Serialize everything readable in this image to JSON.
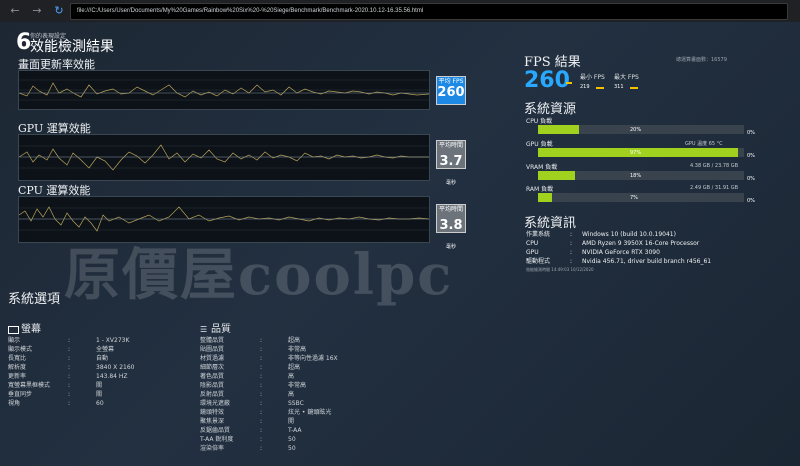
{
  "browser": {
    "url": "file:///C:/Users/User/Documents/My%20Games/Rainbow%20Six%20-%20Siege/Benchmark/Benchmark-2020.10.12-16.35.56.html"
  },
  "header": {
    "logo_number": "6",
    "subtitle": "你的表現設定",
    "title": "效能檢測結果"
  },
  "charts": [
    {
      "title": "畫面更新率效能",
      "label": "平均 FPS",
      "value": "260",
      "unit": "",
      "style": "blue"
    },
    {
      "title": "GPU 運算效能",
      "label": "平均時間",
      "value": "3.7",
      "unit": "毫秒",
      "style": "gray"
    },
    {
      "title": "CPU 運算效能",
      "label": "平均時間",
      "value": "3.8",
      "unit": "毫秒",
      "style": "gray"
    }
  ],
  "fps": {
    "title": "FPS 結果",
    "total_frames_label": "總運算畫面數：16579",
    "avg": "260",
    "min_label": "最小 FPS",
    "max_label": "最大 FPS",
    "min_value": "219",
    "max_value": "311"
  },
  "resources": {
    "title": "系統資源",
    "rows": [
      {
        "label": "CPU 負載",
        "pct": 20,
        "pct_text": "20%",
        "right": "",
        "end": "0%"
      },
      {
        "label": "GPU 負載",
        "pct": 97,
        "pct_text": "97%",
        "right": "GPU 溫度 65 °C",
        "end": "0%"
      },
      {
        "label": "VRAM 負載",
        "pct": 18,
        "pct_text": "18%",
        "right": "4.38 GB / 23.78 GB",
        "end": "0%"
      },
      {
        "label": "RAM 負載",
        "pct": 7,
        "pct_text": "7%",
        "right": "2.49 GB / 31.91 GB",
        "end": "0%"
      }
    ]
  },
  "sysinfo": {
    "title": "系統資訊",
    "rows": [
      {
        "k": "作業系統",
        "c": ":",
        "v": "Windows 10 (build 10.0.19041)"
      },
      {
        "k": "CPU",
        "c": ":",
        "v": "AMD Ryzen 9 3950X 16-Core Processor"
      },
      {
        "k": "GPU",
        "c": ":",
        "v": "NVIDIA GeForce RTX 3090"
      },
      {
        "k": "驅動程式",
        "c": ":",
        "v": "Nvidia 456.71, driver build branch r456_61"
      }
    ],
    "note": "效能檢測時間 14:49:03  10/12/2020"
  },
  "options": {
    "title": "系統選項",
    "display": {
      "title": "螢幕",
      "rows": [
        {
          "k": "顯示",
          "v": "1 - XV273K"
        },
        {
          "k": "顯示模式",
          "v": "全螢幕"
        },
        {
          "k": "長寬比",
          "v": "自動"
        },
        {
          "k": "解析度",
          "v": "3840 X 2160"
        },
        {
          "k": "更新率",
          "v": "143.84 HZ"
        },
        {
          "k": "寬螢幕黑框模式",
          "v": "關"
        },
        {
          "k": "垂直同步",
          "v": "關"
        },
        {
          "k": "視角",
          "v": "60"
        }
      ]
    },
    "quality": {
      "title": "品質",
      "rows": [
        {
          "k": "整體品質",
          "v": "超高"
        },
        {
          "k": "貼圖品質",
          "v": "非常高"
        },
        {
          "k": "材質過濾",
          "v": "非等向性過濾 16X"
        },
        {
          "k": "細節層次",
          "v": "超高"
        },
        {
          "k": "著色品質",
          "v": "高"
        },
        {
          "k": "陰影品質",
          "v": "非常高"
        },
        {
          "k": "反射品質",
          "v": "高"
        },
        {
          "k": "環境光遮蔽",
          "v": "SSBC"
        },
        {
          "k": "鏡頭特效",
          "v": "炫光 • 鏡頭眩光"
        },
        {
          "k": "聚焦景深",
          "v": "開"
        },
        {
          "k": "反鋸齒品質",
          "v": "T-AA"
        },
        {
          "k": "T-AA 銳利度",
          "v": "50"
        },
        {
          "k": "渲染倍率",
          "v": "50"
        }
      ]
    }
  },
  "watermark": "原價屋coolpc",
  "colors": {
    "accent_blue": "#29a8ff",
    "bar_green": "#9fd11e",
    "line_yellow": "#b8a45a"
  }
}
